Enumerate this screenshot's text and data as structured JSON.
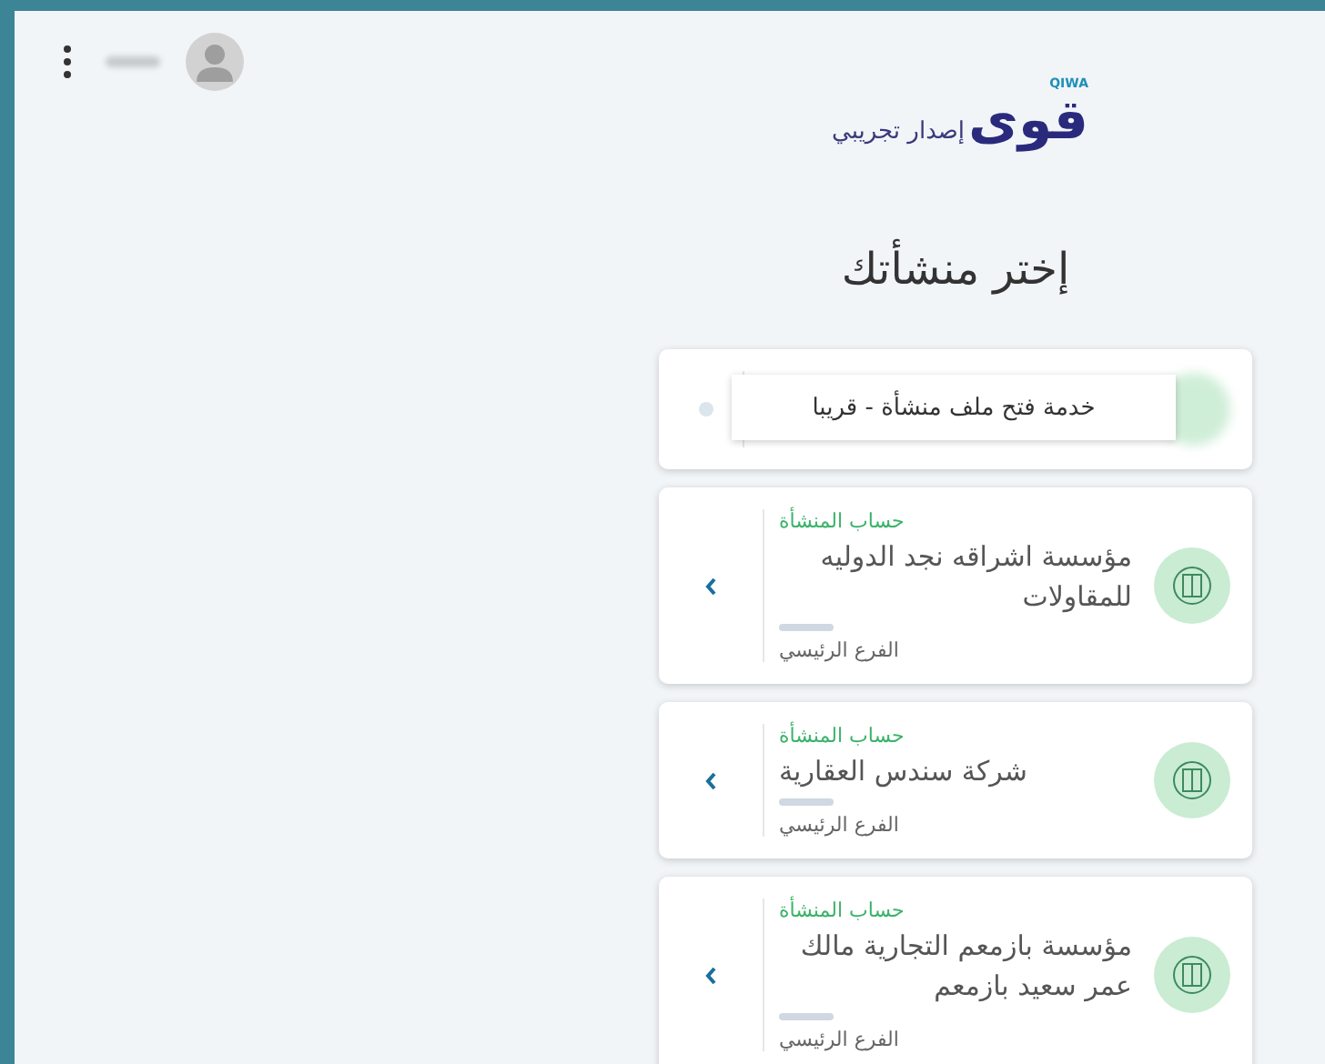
{
  "header": {
    "logo_text": "قوى",
    "logo_mark": "QIWA",
    "logo_subtitle": "إصدار تجريبي"
  },
  "title": "إختر منشأتك",
  "tooltip": "خدمة فتح ملف منشأة - قريبا",
  "establishments": [
    {
      "label": "حساب المنشأة",
      "name": "مؤسسة اشراقه نجد الدوليه للمقاولات",
      "branch": "الفرع الرئيسي"
    },
    {
      "label": "حساب المنشأة",
      "name": "شركة سندس العقارية",
      "branch": "الفرع الرئيسي"
    },
    {
      "label": "حساب المنشأة",
      "name": "مؤسسة بازمعم التجارية مالك عمر سعيد بازمعم",
      "branch": "الفرع الرئيسي"
    }
  ]
}
